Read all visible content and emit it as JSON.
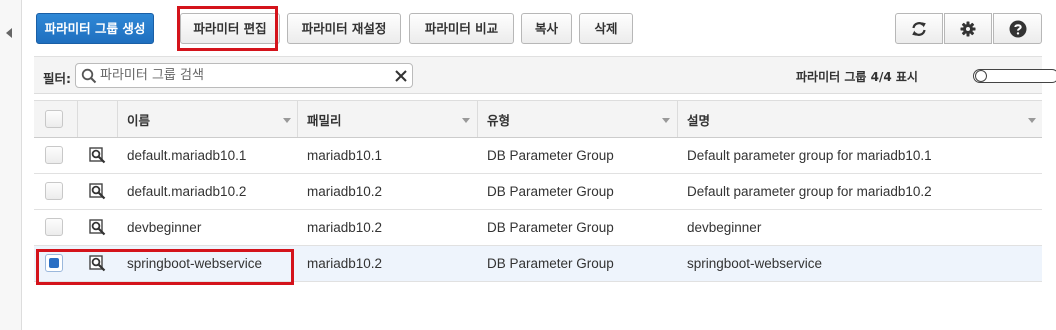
{
  "toolbar": {
    "create_group": "파라미터 그룹 생성",
    "edit_params": "파라미터 편집",
    "reset_params": "파라미터 재설정",
    "compare_params": "파라미터 비교",
    "copy": "복사",
    "delete": "삭제",
    "icons": [
      "refresh-icon",
      "gear-icon",
      "help-icon"
    ]
  },
  "filter": {
    "label": "필터:",
    "placeholder": "파라미터 그룹 검색",
    "count_text": "파라미터 그룹 4/4 표시"
  },
  "table": {
    "columns": [
      "이름",
      "패밀리",
      "유형",
      "설명"
    ],
    "rows": [
      {
        "name": "default.mariadb10.1",
        "family": "mariadb10.1",
        "type": "DB Parameter Group",
        "description": "Default parameter group for mariadb10.1",
        "checked": false
      },
      {
        "name": "default.mariadb10.2",
        "family": "mariadb10.2",
        "type": "DB Parameter Group",
        "description": "Default parameter group for mariadb10.2",
        "checked": false
      },
      {
        "name": "devbeginner",
        "family": "mariadb10.2",
        "type": "DB Parameter Group",
        "description": "devbeginner",
        "checked": false
      },
      {
        "name": "springboot-webservice",
        "family": "mariadb10.2",
        "type": "DB Parameter Group",
        "description": "springboot-webservice",
        "checked": true
      }
    ]
  },
  "colors": {
    "primary": "#1f6fbf",
    "highlight": "#d4131b",
    "selected_row": "#eef4fc"
  }
}
